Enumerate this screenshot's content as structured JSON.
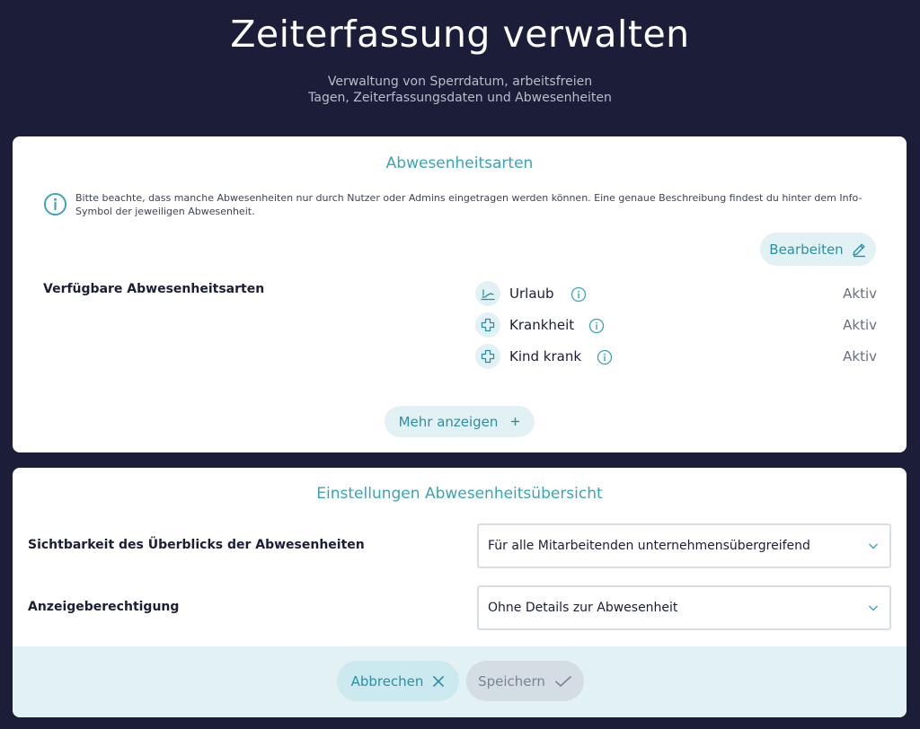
{
  "header": {
    "title": "Zeiterfassung verwalten",
    "subtitle_line1": "Verwaltung von Sperrdatum, arbeitsfreien",
    "subtitle_line2": "Tagen, Zeiterfassungsdaten und Abwesenheiten"
  },
  "absence_types": {
    "title": "Abwesenheitsarten",
    "info_text": "Bitte beachte, dass manche Abwesenheiten nur durch Nutzer oder Admins eingetragen werden können. Eine genaue Beschreibung findest du hinter dem Info-Symbol der jeweiligen Abwesenheit.",
    "edit_label": "Bearbeiten",
    "available_label": "Verfügbare Abwesenheitsarten",
    "items": [
      {
        "name": "Urlaub",
        "icon": "beach-icon",
        "status": "Aktiv"
      },
      {
        "name": "Krankheit",
        "icon": "medical-cross-icon",
        "status": "Aktiv"
      },
      {
        "name": "Kind krank",
        "icon": "medical-cross-icon",
        "status": "Aktiv"
      }
    ],
    "more_label": "Mehr anzeigen"
  },
  "overview_settings": {
    "title": "Einstellungen Abwesenheitsübersicht",
    "visibility_label": "Sichtbarkeit des Überblicks der Abwesenheiten",
    "visibility_value": "Für alle Mitarbeitenden unternehmensübergreifend",
    "permission_label": "Anzeigeberechtigung",
    "permission_value": "Ohne Details zur Abwesenheit",
    "cancel_label": "Abbrechen",
    "save_label": "Speichern"
  },
  "colors": {
    "background": "#1c1d38",
    "accent": "#3aa3b7",
    "pill_bg": "#e2f1f4"
  }
}
